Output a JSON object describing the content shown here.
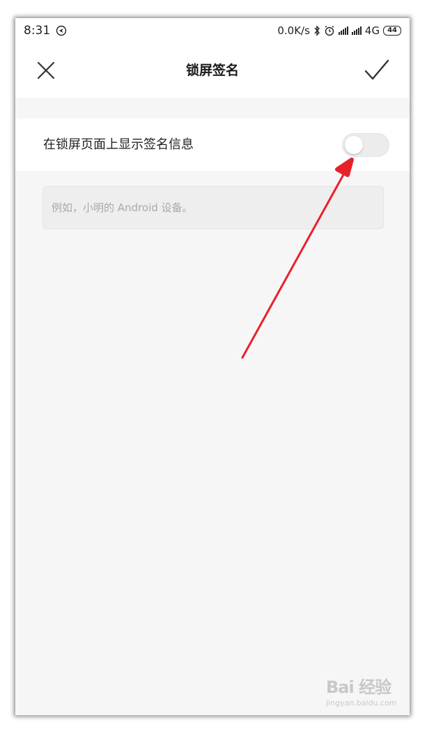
{
  "status_bar": {
    "time": "8:31",
    "network_speed": "0.0K/s",
    "network_type": "4G",
    "battery": "44",
    "icons": [
      "navigation-icon",
      "bluetooth-icon",
      "alarm-icon",
      "signal-icon",
      "signal-icon"
    ]
  },
  "header": {
    "title": "锁屏签名",
    "close_icon": "close-icon",
    "confirm_icon": "check-icon"
  },
  "settings": {
    "toggle_label": "在锁屏页面上显示签名信息",
    "toggle_on": false
  },
  "signature_input": {
    "value": "",
    "placeholder": "例如，小明的 Android 设备。"
  },
  "annotation": {
    "color": "#e8202a"
  },
  "watermark": {
    "logo": "Bai 经验",
    "url": "jingyan.baidu.com"
  }
}
